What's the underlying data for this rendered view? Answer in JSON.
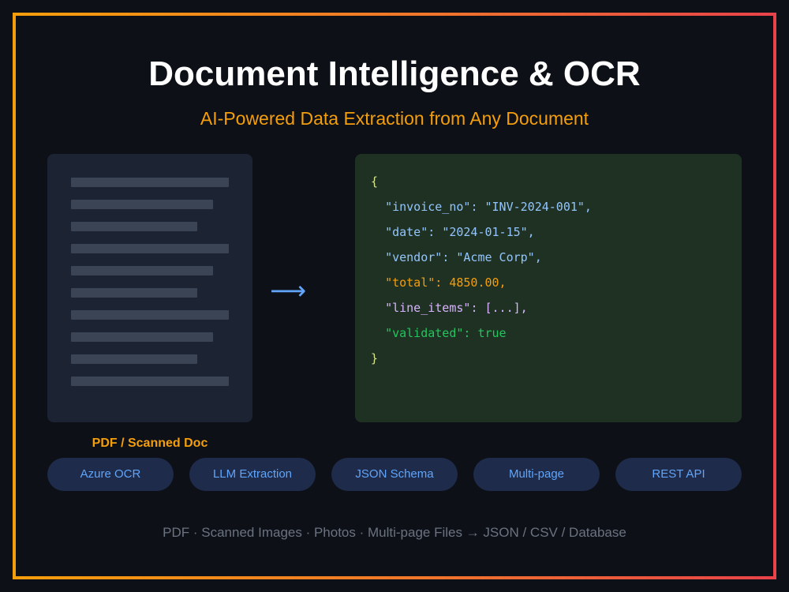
{
  "header": {
    "title": "Document Intelligence & OCR",
    "subtitle": "AI-Powered Data Extraction from Any Document"
  },
  "source_document": {
    "label": "PDF / Scanned Doc",
    "icon": "document-placeholder-icon"
  },
  "arrow": {
    "glyph": "⟶",
    "icon": "right-arrow-icon"
  },
  "json_output": {
    "open_brace": "{",
    "fields": [
      {
        "key": "\"invoice_no\"",
        "sep": ": ",
        "value": "\"INV-2024-001\",",
        "color": "blue"
      },
      {
        "key": "\"date\"",
        "sep": ": ",
        "value": "\"2024-01-15\",",
        "color": "blue"
      },
      {
        "key": "\"vendor\"",
        "sep": ": ",
        "value": "\"Acme Corp\",",
        "color": "blue"
      },
      {
        "key": "\"total\"",
        "sep": ": ",
        "value": "4850.00,",
        "color": "orange"
      },
      {
        "key": "\"line_items\"",
        "sep": ": ",
        "value": "[...],",
        "color": "purple"
      },
      {
        "key": "\"validated\"",
        "sep": ": ",
        "value": "true",
        "color": "green"
      }
    ],
    "close_brace": "}"
  },
  "features": [
    "Azure OCR",
    "LLM Extraction",
    "JSON Schema",
    "Multi-page",
    "REST API"
  ],
  "footer": "PDF · Scanned Images · Photos · Multi-page Files → JSON / CSV / Database",
  "colors": {
    "background": "#0d1117",
    "accent_orange": "#f59e0b",
    "accent_red": "#e8424a",
    "accent_blue": "#60a5fa",
    "json_panel": "#1f3123",
    "doc_panel": "#1c2333"
  }
}
